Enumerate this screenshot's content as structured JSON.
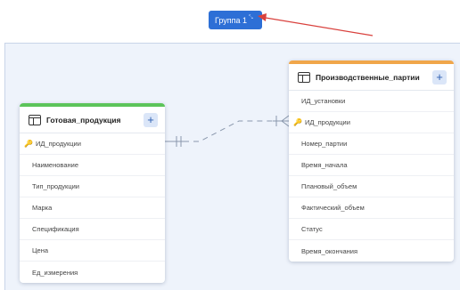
{
  "group_chip": {
    "label": "Группа 1",
    "edit_glyph": "⤡"
  },
  "annotation": {
    "arrow_color": "#d9413d"
  },
  "entities": {
    "left": {
      "title": "Готовая_продукция",
      "accent_color": "#5cc45a",
      "add_glyph": "+",
      "key_glyph": "🔑",
      "fields": [
        "ИД_продукции",
        "Наименование",
        "Тип_продукции",
        "Марка",
        "Спецификация",
        "Цена",
        "Ед_измерения"
      ]
    },
    "right": {
      "title": "Производственные_партии",
      "accent_color": "#f0a64a",
      "add_glyph": "+",
      "key_glyph": "🔑",
      "fields": [
        "ИД_установки",
        "ИД_продукции",
        "Номер_партии",
        "Время_начала",
        "Плановый_объем",
        "Фактический_объем",
        "Статус",
        "Время_окончания"
      ]
    }
  },
  "relationship": {
    "from_cardinality": "one",
    "to_cardinality": "many",
    "line_style": "dashed"
  }
}
